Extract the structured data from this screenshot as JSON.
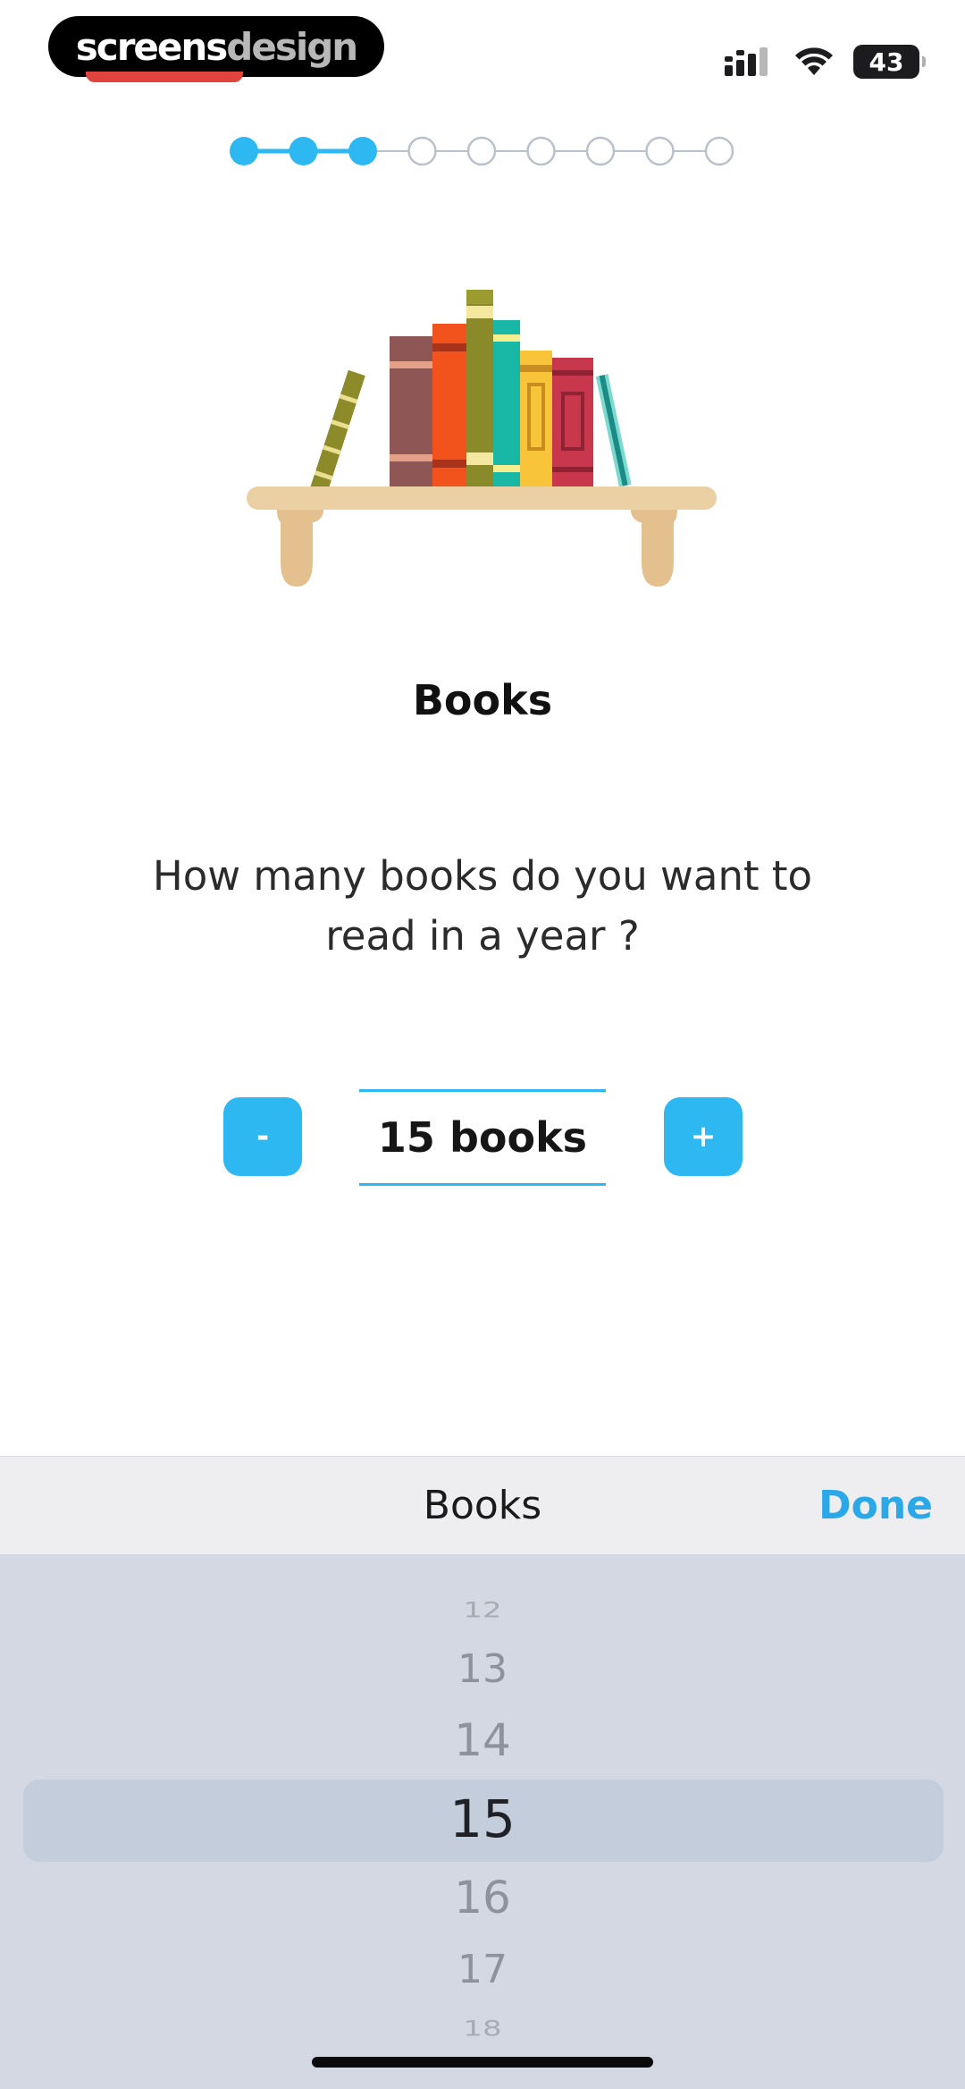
{
  "status_bar": {
    "watermark_part1": "screens",
    "watermark_part2": "design",
    "battery_level": "43",
    "icons": [
      "signal-icon",
      "wifi-icon",
      "battery-icon"
    ]
  },
  "progress": {
    "total_steps": 9,
    "completed_steps": 3,
    "active_color": "#2eb8f2",
    "inactive_color": "#b9c2cc"
  },
  "main": {
    "title": "Books",
    "question_line1": "How many books do you want to",
    "question_line2": "read in a year ?",
    "minus_label": "-",
    "plus_label": "+",
    "value_text": "15 books"
  },
  "picker": {
    "title": "Books",
    "done_label": "Done",
    "items": [
      "12",
      "13",
      "14",
      "15",
      "16",
      "17",
      "18"
    ],
    "selected": "15"
  },
  "colors": {
    "accent": "#2eb8f2",
    "done": "#2aa8e8",
    "picker_bg": "#d4d8e2",
    "toolbar_bg": "#eeeef1"
  }
}
